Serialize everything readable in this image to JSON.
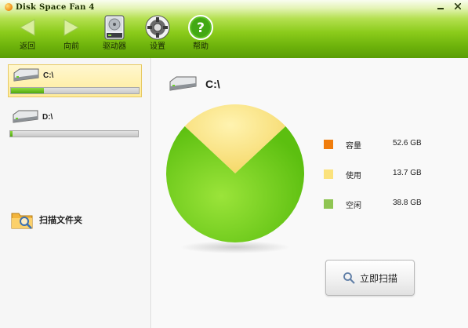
{
  "app": {
    "title": "Disk Space Fan 4"
  },
  "window_controls": [
    "minimize",
    "close"
  ],
  "toolbar": {
    "back_label": "返回",
    "forward_label": "向前",
    "drives_label": "驱动器",
    "settings_label": "设置",
    "help_label": "帮助"
  },
  "sidebar": {
    "drives": [
      {
        "label": "C:\\",
        "used_fraction": 0.26,
        "selected": true
      },
      {
        "label": "D:\\",
        "used_fraction": 0.02,
        "selected": false
      }
    ],
    "scan_folder_label": "扫描文件夹"
  },
  "main": {
    "drive_label": "C:\\",
    "legend": [
      {
        "name": "容量",
        "value": "52.6 GB",
        "color": "#f07d0c"
      },
      {
        "name": "使用",
        "value": "13.7 GB",
        "color": "#fbe27c"
      },
      {
        "name": "空闲",
        "value": "38.8 GB",
        "color": "#8fc552"
      }
    ],
    "scan_button_label": "立即扫描"
  },
  "chart_data": {
    "type": "pie",
    "title": "",
    "slices": [
      {
        "label": "使用",
        "value": 13.7,
        "color": "#fbe27c"
      },
      {
        "label": "空闲",
        "value": 38.8,
        "color": "#7ccf18"
      }
    ]
  },
  "colors": {
    "toolbar_green": "#6fb40c",
    "selection_yellow": "#ffec9a",
    "used_bar_green": "#4ea80e"
  }
}
